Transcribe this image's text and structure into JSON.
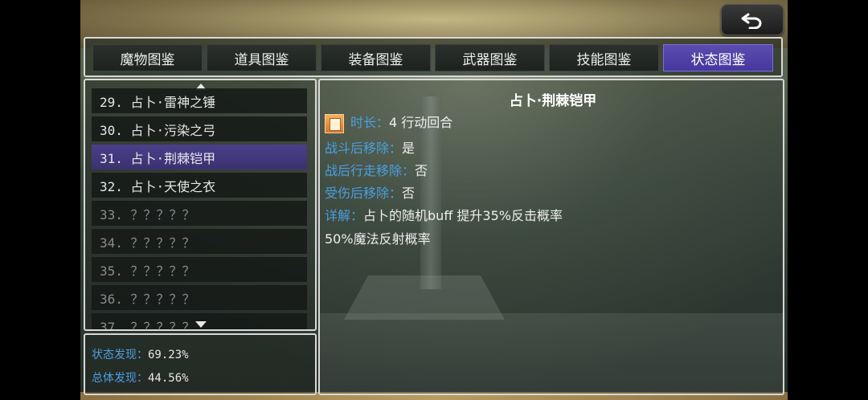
{
  "tabs": [
    {
      "label": "魔物图鉴",
      "active": false
    },
    {
      "label": "道具图鉴",
      "active": false
    },
    {
      "label": "装备图鉴",
      "active": false
    },
    {
      "label": "武器图鉴",
      "active": false
    },
    {
      "label": "技能图鉴",
      "active": false
    },
    {
      "label": "状态图鉴",
      "active": true
    }
  ],
  "list": {
    "items": [
      {
        "text": "29. 占卜·雷神之锤",
        "state": "normal"
      },
      {
        "text": "30. 占卜·污染之弓",
        "state": "normal"
      },
      {
        "text": "31. 占卜·荆棘铠甲",
        "state": "selected"
      },
      {
        "text": "32. 占卜·天使之衣",
        "state": "normal"
      },
      {
        "text": "33. ？？？？？",
        "state": "locked"
      },
      {
        "text": "34. ？？？？？",
        "state": "locked"
      },
      {
        "text": "35. ？？？？？",
        "state": "locked"
      },
      {
        "text": "36. ？？？？？",
        "state": "locked"
      },
      {
        "text": "37. ？？？？？",
        "state": "locked"
      }
    ]
  },
  "stats": {
    "status_label": "状态发现：",
    "status_value": "69.23%",
    "total_label": "总体发现：",
    "total_value": "44.56%"
  },
  "detail": {
    "title": "占卜·荆棘铠甲",
    "icon": "status-effect-icon",
    "duration_label": "时长：",
    "duration_value": "4 行动回合",
    "battle_remove_label": "战斗后移除：",
    "battle_remove_value": "是",
    "walk_remove_label": "战后行走移除：",
    "walk_remove_value": "否",
    "hurt_remove_label": "受伤后移除：",
    "hurt_remove_value": "否",
    "desc_label": "详解：",
    "desc_line1": "占卜的随机buff 提升35%反击概率",
    "desc_line2": "50%魔法反射概率"
  },
  "colors": {
    "label_blue": "#4a9fe0",
    "active_tab": "#4637a0",
    "selected_item": "#3b3170"
  }
}
